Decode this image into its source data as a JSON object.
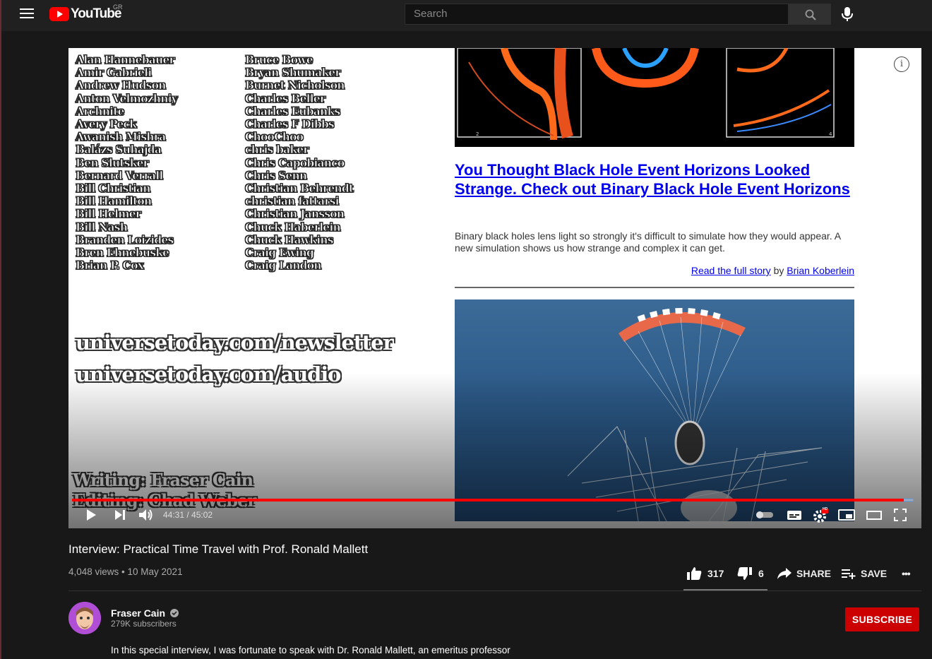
{
  "header": {
    "logo_text": "YouTube",
    "country": "GR",
    "search_placeholder": "Search"
  },
  "player": {
    "supporters_col1": [
      "Alan Hannebauer",
      "Amir Gabrieli",
      "Andrew Hudson",
      "Anton Velmozhniy",
      "Archnite",
      "Avery Peck",
      "Awanish Mishra",
      "Balázs Suhajda",
      "Ben Slutsker",
      "Bernard Verrall",
      "Bill Christian",
      "Bill Hamilton",
      "Bill Helmer",
      "Bill Nash",
      "Branden Loizides",
      "Bren Ehnebuske",
      "Brian P. Cox"
    ],
    "supporters_col2": [
      "Bruce Bowe",
      "Bryan Shumaker",
      "Burnet Nicholson",
      "Charles Beller",
      "Charles Eubanks",
      "Charles F Dibbs",
      "ChooChoo",
      "chris baker",
      "Chris Capobianco",
      "Chris Senn",
      "Christian Behrendt",
      "christian fattarsi",
      "Christian Jansson",
      "Chuck Haberlein",
      "Chuck Hawkins",
      "Craig Ewing",
      "Craig Landon"
    ],
    "url1": "universetoday.com/newsletter",
    "url2": "universetoday.com/audio",
    "credit_writing": "Writing: Fraser Cain",
    "credit_editing": "Editing: Chad Weber",
    "sim_label_left": "2",
    "sim_label_right": "4",
    "news": {
      "title": "You Thought Black Hole Event Horizons Looked Strange. Check out Binary Black Hole Event Horizons",
      "description": "Binary black holes lens light so strongly it's difficult to simulate how they would appear. A new simulation shows us how strange and complex it can get.",
      "read_link": "Read the full story",
      "by": "by",
      "author": "Brian Koberlein"
    },
    "time": "44:31 / 45:02",
    "progress": 0.9883,
    "hd_badge": "HD",
    "info_icon": "i"
  },
  "video": {
    "title": "Interview: Practical Time Travel with Prof. Ronald Mallett",
    "meta": "4,048 views • 10 May 2021",
    "likes": "317",
    "dislikes": "6",
    "share": "SHARE",
    "save": "SAVE",
    "more": "•••"
  },
  "channel": {
    "name": "Fraser Cain",
    "subscribers": "279K subscribers",
    "subscribe_label": "SUBSCRIBE"
  },
  "description": "In this special interview, I was fortunate to speak with Dr. Ronald Mallett, an emeritus professor",
  "colors": {
    "accent": "#ff0000",
    "subscribe": "#cc0000",
    "link": "#0000ee"
  }
}
